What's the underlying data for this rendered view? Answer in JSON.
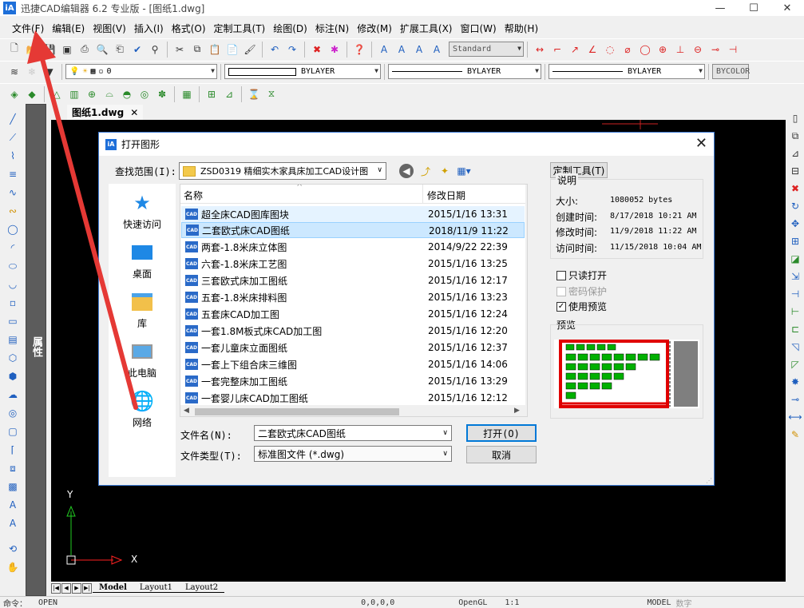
{
  "window": {
    "logo": "iA",
    "title": "迅捷CAD编辑器 6.2 专业版  - [图纸1.dwg]",
    "minimize": "—",
    "maximize": "☐",
    "close": "✕"
  },
  "menu": [
    "文件(F)",
    "编辑(E)",
    "视图(V)",
    "插入(I)",
    "格式(O)",
    "定制工具(T)",
    "绘图(D)",
    "标注(N)",
    "修改(M)",
    "扩展工具(X)",
    "窗口(W)",
    "帮助(H)"
  ],
  "toolbar": {
    "text_style": "Standard",
    "layer_value": "0",
    "color_value": "BYLAYER",
    "linetype_value": "BYLAYER",
    "lineweight_value": "BYLAYER",
    "plot_style": "BYCOLOR"
  },
  "properties_panel": {
    "label": "属性"
  },
  "document_tab": {
    "label": "图纸1.dwg",
    "close": "✕"
  },
  "canvas": {
    "background": "#000000",
    "axis_color": "#22cc22",
    "x_axis_color": "#ff2222",
    "y_label": "Y",
    "x_label": "X"
  },
  "layouts": {
    "model": "Model",
    "layout1": "Layout1",
    "layout2": "Layout2"
  },
  "status": {
    "command_label": "命令：",
    "command_value": "OPEN",
    "coords": "0,0,0,0",
    "opengl": "OpenGL",
    "scale": "1:1",
    "model": "MODEL",
    "digitize": "数字"
  },
  "dialog": {
    "logo": "iA",
    "title": "打开图形",
    "close": "✕",
    "look_in_label": "查找范围(I):",
    "look_in_value": "ZSD0319   精细实木家具床加工CAD设计图",
    "places": [
      "快速访问",
      "桌面",
      "库",
      "此电脑",
      "网络"
    ],
    "columns": {
      "name": "名称",
      "date": "修改日期",
      "sort": "^"
    },
    "files": [
      {
        "name": "超全床CAD图库图块",
        "date": "2015/1/16 13:31"
      },
      {
        "name": "二套欧式床CAD图纸",
        "date": "2018/11/9 11:22"
      },
      {
        "name": "两套-1.8米床立体图",
        "date": "2014/9/22 22:39"
      },
      {
        "name": "六套-1.8米床工艺图",
        "date": "2015/1/16 13:25"
      },
      {
        "name": "三套欧式床加工图纸",
        "date": "2015/1/16 12:17"
      },
      {
        "name": "五套-1.8米床排料图",
        "date": "2015/1/16 13:23"
      },
      {
        "name": "五套床CAD加工图",
        "date": "2015/1/16 12:24"
      },
      {
        "name": "一套1.8M板式床CAD加工图",
        "date": "2015/1/16 12:20"
      },
      {
        "name": "一套儿童床立面图纸",
        "date": "2015/1/16 12:37"
      },
      {
        "name": "一套上下组合床三维图",
        "date": "2015/1/16 14:06"
      },
      {
        "name": "一套完整床加工图纸",
        "date": "2015/1/16 13:29"
      },
      {
        "name": "一套婴儿床CAD加工图纸",
        "date": "2015/1/16 12:12"
      }
    ],
    "file_icon_label": "CAD",
    "filename_label": "文件名(N):",
    "filename_value": "二套欧式床CAD图纸",
    "filetype_label": "文件类型(T):",
    "filetype_value": "标准图文件 (*.dwg)",
    "open_button": "打开(O)",
    "cancel_button": "取消",
    "custom_tool_button": "定制工具(T)",
    "info": {
      "title": "说明",
      "size_label": "大小:",
      "size_value": "1080052 bytes",
      "created_label": "创建时间:",
      "created_value": "8/17/2018 10:21 AM",
      "modified_label": "修改时间:",
      "modified_value": "11/9/2018 11:22 AM",
      "accessed_label": "访问时间:",
      "accessed_value": "11/15/2018 10:04 AM"
    },
    "readonly_label": "只读打开",
    "password_label": "密码保护",
    "use_preview_label": "使用预览",
    "use_preview_checked": "✓",
    "preview_label": "预览"
  }
}
